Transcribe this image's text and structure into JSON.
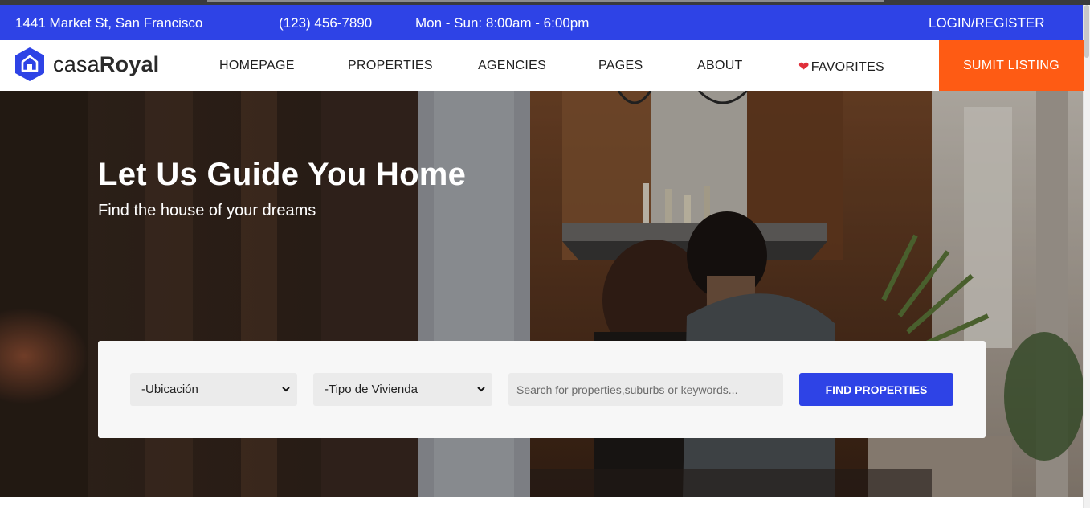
{
  "topbar": {
    "address": "1441 Market St, San Francisco",
    "phone": "(123) 456-7890",
    "hours": "Mon - Sun: 8:00am - 6:00pm",
    "login": "LOGIN/REGISTER",
    "background_color": "#2e43e6"
  },
  "brand": {
    "name_light": "casa",
    "name_bold": "Royal",
    "logo_icon": "hexagon-house-icon",
    "color": "#2e43e6"
  },
  "nav": {
    "items": [
      {
        "label": "HOMEPAGE"
      },
      {
        "label": "PROPERTIES"
      },
      {
        "label": "AGENCIES"
      },
      {
        "label": "PAGES"
      },
      {
        "label": "ABOUT"
      },
      {
        "label": "FAVORITES",
        "icon": "heart-icon"
      }
    ],
    "cta_label": "SUMIT LISTING",
    "cta_color": "#fe5b14"
  },
  "hero": {
    "title": "Let Us Guide You Home",
    "subtitle": "Find the house of your dreams",
    "background": "couple-in-kitchen-photo"
  },
  "search": {
    "location_select": "-Ubicación",
    "type_select": "-Tipo de Vivienda",
    "keyword_placeholder": "Search for properties,suburbs or keywords...",
    "button_label": "FIND PROPERTIES"
  }
}
